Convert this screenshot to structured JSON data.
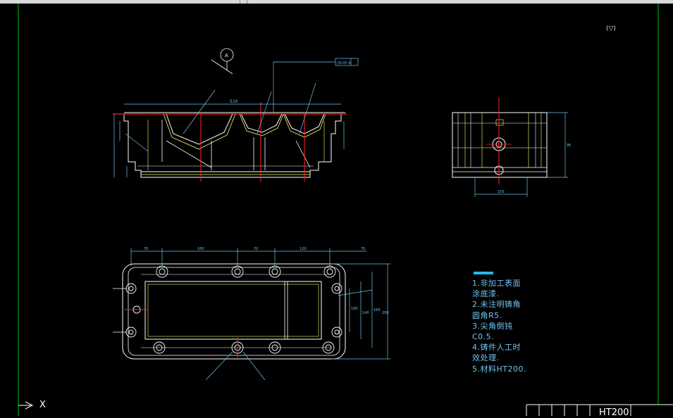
{
  "app": {
    "name": "CAD drawing viewport",
    "background": "#000000"
  },
  "drawing": {
    "roughness_symbol": "(▽)",
    "front_view": {
      "overall_width_dim": "510",
      "callout_flatness": "//0.05 A"
    },
    "side_view": {
      "width_dim": "150",
      "height_dim": "95"
    },
    "top_view": {
      "top_dims": [
        "70",
        "160",
        "70",
        "120",
        "70"
      ],
      "right_dims": [
        "190",
        "140",
        "160",
        "200"
      ]
    },
    "tech_notes": [
      "1.非加工表面",
      "涂底漆.",
      "2.未注明铸角",
      "圆角R5.",
      "3.尖角倒钝",
      "C0.5.",
      "4.铸件人工时",
      "效处理.",
      "5.材料HT200."
    ],
    "title_block": {
      "material": "HT200"
    },
    "ucs": {
      "x_label": "X"
    }
  },
  "colors": {
    "outline": "#ffffff",
    "centerline": "#ff2020",
    "hidden": "#ffff66",
    "dimension": "#6ec3f0",
    "frame": "#00c000"
  }
}
